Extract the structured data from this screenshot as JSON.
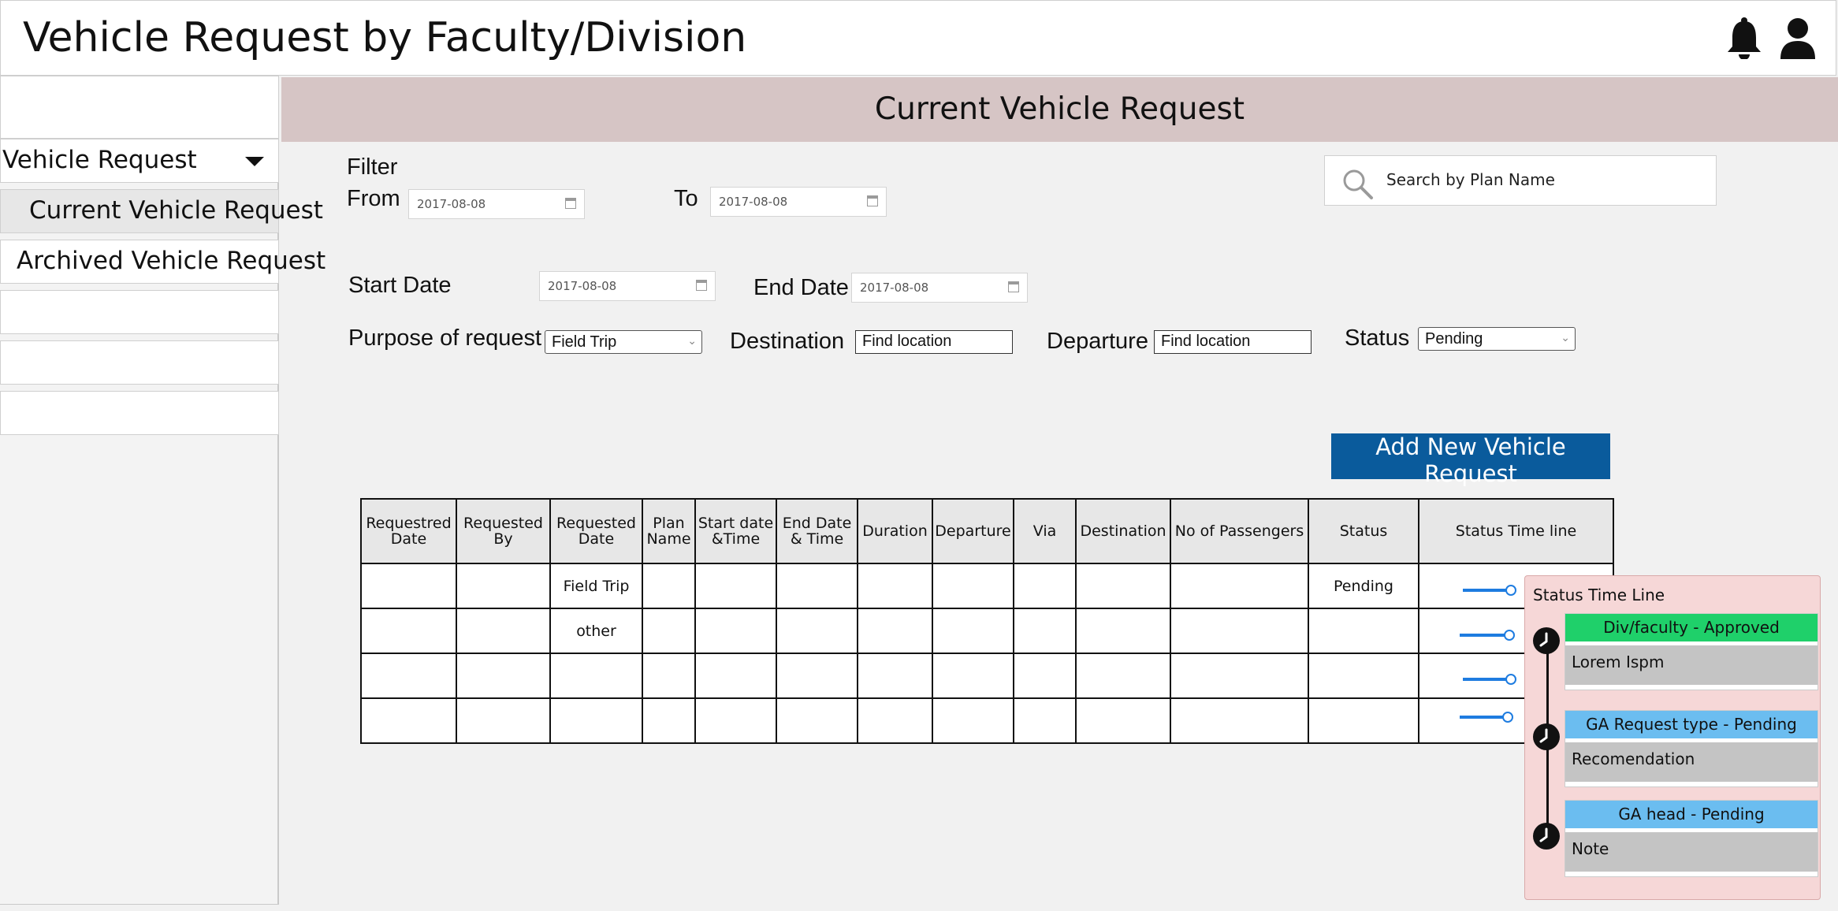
{
  "app": {
    "title": "Vehicle Request by Faculty/Division"
  },
  "header": {
    "notifications_icon": "bell-icon",
    "profile_icon": "user-icon"
  },
  "sidebar": {
    "dropdown_label": "Vehicle Request",
    "items": [
      {
        "label": "Current Vehicle Request",
        "active": true
      },
      {
        "label": "Archived Vehicle Request",
        "active": false
      }
    ]
  },
  "page": {
    "banner_title": "Current Vehicle Request"
  },
  "filter": {
    "label": "Filter",
    "from_label": "From",
    "from_value": "2017-08-08",
    "to_label": "To",
    "to_value": "2017-08-08"
  },
  "search": {
    "placeholder": "Search by Plan Name",
    "icon": "search-icon"
  },
  "form": {
    "start_date_label": "Start Date",
    "start_date_value": "2017-08-08",
    "end_date_label": "End Date",
    "end_date_value": "2017-08-08",
    "purpose_label": "Purpose of request",
    "purpose_value": "Field Trip",
    "destination_label": "Destination",
    "destination_value": "Find location",
    "departure_label": "Departure",
    "departure_value": "Find location",
    "status_label": "Status",
    "status_value": "Pending"
  },
  "actions": {
    "add_button": "Add New Vehicle Request"
  },
  "table": {
    "headers": [
      "Requestred Date",
      "Requested By",
      "Requested Date",
      "Plan Name",
      "Start date &Time",
      "End Date & Time",
      "Duration",
      "Departure",
      "Via",
      "Destination",
      "No of Passengers",
      "Status",
      "Status Time line"
    ],
    "rows": [
      [
        "",
        "",
        "Field Trip",
        "",
        "",
        "",
        "",
        "",
        "",
        "",
        "",
        "Pending"
      ],
      [
        "",
        "",
        "other",
        "",
        "",
        "",
        "",
        "",
        "",
        "",
        "",
        ""
      ],
      [
        "",
        "",
        "",
        "",
        "",
        "",
        "",
        "",
        "",
        "",
        "",
        ""
      ],
      [
        "",
        "",
        "",
        "",
        "",
        "",
        "",
        "",
        "",
        "",
        "",
        ""
      ]
    ]
  },
  "timeline_popup": {
    "title": "Status Time Line",
    "entries": [
      {
        "status": "Div/faculty - Approved",
        "note": "Lorem Ispm",
        "color": "#1fd06a"
      },
      {
        "status": "GA Request type - Pending",
        "note": "Recomendation",
        "color": "#6bbdf0"
      },
      {
        "status": "GA head - Pending",
        "note": "Note",
        "color": "#6bbdf0"
      }
    ]
  }
}
